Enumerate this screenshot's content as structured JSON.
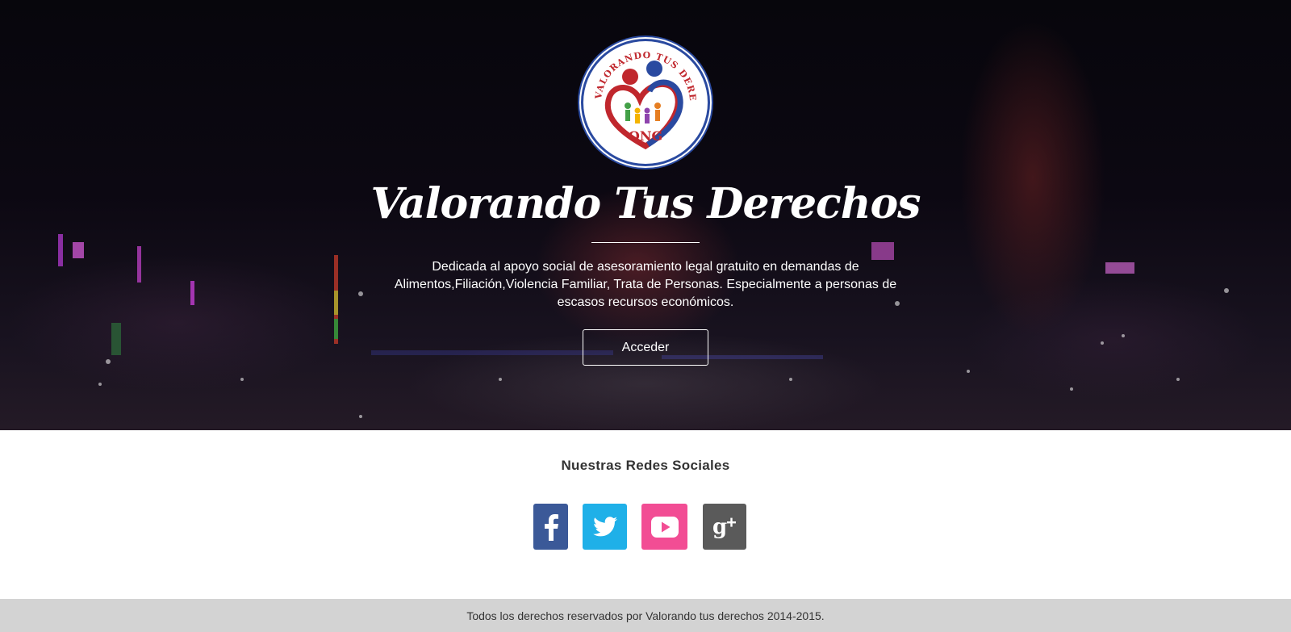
{
  "hero": {
    "logo": {
      "ring_text": "VALORANDO TUS DERECHOS",
      "badge_text": "ONG"
    },
    "title": "Valorando Tus Derechos",
    "description": "Dedicada al apoyo social de asesoramiento legal gratuito en demandas de Alimentos,Filiación,Violencia Familiar, Trata de Personas. Especialmente a personas de escasos recursos económicos.",
    "cta_label": "Acceder"
  },
  "social": {
    "title": "Nuestras Redes Sociales",
    "items": [
      {
        "name": "Facebook",
        "icon": "facebook-icon",
        "color": "#3b5998"
      },
      {
        "name": "Twitter",
        "icon": "twitter-icon",
        "color": "#1fb0e8"
      },
      {
        "name": "YouTube",
        "icon": "youtube-icon",
        "color": "#f24d94"
      },
      {
        "name": "Google+",
        "icon": "google-plus-icon",
        "color": "#5a5a5a"
      }
    ]
  },
  "footer": {
    "text": "Todos los derechos reservados por Valorando tus derechos 2014-2015."
  }
}
